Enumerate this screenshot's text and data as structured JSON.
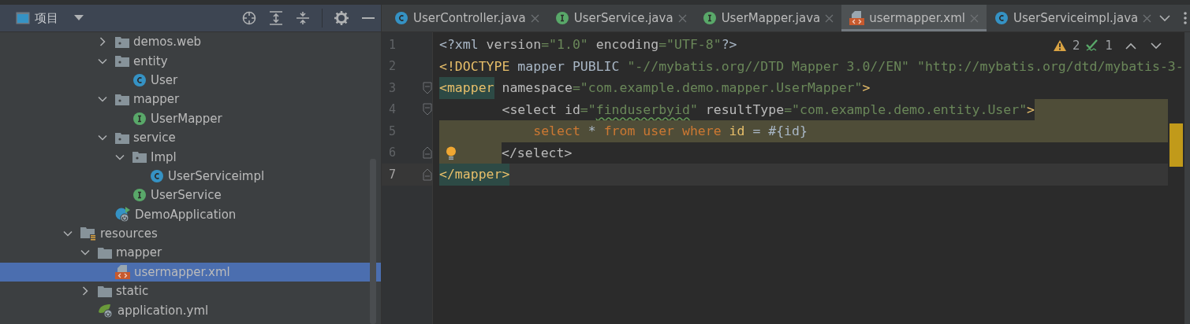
{
  "project_panel": {
    "title": "项目",
    "tree": [
      {
        "children": [
          {
            "children": [
              {
                "label": "demos.web",
                "kind": "package",
                "expanded": false
              },
              {
                "label": "entity",
                "kind": "package",
                "expanded": true,
                "children": [
                  {
                    "label": "User",
                    "kind": "class"
                  }
                ]
              },
              {
                "label": "mapper",
                "kind": "package",
                "expanded": true,
                "children": [
                  {
                    "label": "UserMapper",
                    "kind": "interface"
                  }
                ]
              },
              {
                "label": "service",
                "kind": "package",
                "expanded": true,
                "children": [
                  {
                    "label": "Impl",
                    "kind": "package",
                    "expanded": true,
                    "children": [
                      {
                        "label": "UserServiceimpl",
                        "kind": "class"
                      }
                    ]
                  },
                  {
                    "label": "UserService",
                    "kind": "interface"
                  }
                ]
              },
              {
                "label": "DemoApplication",
                "kind": "app"
              }
            ]
          }
        ]
      },
      {
        "label": "resources",
        "kind": "resources",
        "expanded": true,
        "children": [
          {
            "label": "mapper",
            "kind": "folder",
            "expanded": true,
            "children": [
              {
                "label": "usermapper.xml",
                "kind": "xml",
                "selected": true
              }
            ]
          },
          {
            "label": "static",
            "kind": "folder",
            "expanded": false
          },
          {
            "label": "application.yml",
            "kind": "yml"
          }
        ]
      }
    ]
  },
  "tabs": [
    {
      "label": "UserController.java",
      "kind": "class",
      "selected": false
    },
    {
      "label": "UserService.java",
      "kind": "interface",
      "selected": false
    },
    {
      "label": "UserMapper.java",
      "kind": "interface",
      "selected": false
    },
    {
      "label": "usermapper.xml",
      "kind": "xml",
      "selected": true
    },
    {
      "label": "UserServiceimpl.java",
      "kind": "class",
      "selected": false
    }
  ],
  "inspections": {
    "warnings": "2",
    "weak_warnings": "1"
  },
  "code_lines": [
    {
      "number": "1",
      "tokens": [
        {
          "text": "<?xml ",
          "kind": "plain"
        },
        {
          "text": "version",
          "kind": "attr"
        },
        {
          "text": "=\"1.0\" ",
          "kind": "value"
        },
        {
          "text": "encoding",
          "kind": "attr"
        },
        {
          "text": "=\"UTF-8\"",
          "kind": "value"
        },
        {
          "text": "?>",
          "kind": "plain"
        }
      ]
    },
    {
      "number": "2",
      "tokens": [
        {
          "text": "<!DOCTYPE ",
          "kind": "tag"
        },
        {
          "text": "mapper PUBLIC ",
          "kind": "plain"
        },
        {
          "text": "\"-//mybatis.org//DTD Mapper 3.0//EN\" \"http://mybatis.org/dtd/mybatis-3-",
          "kind": "value"
        }
      ]
    },
    {
      "number": "3",
      "fold_open": true,
      "tokens": [
        {
          "text": "<mapper",
          "kind": "tag",
          "matched": true
        },
        {
          "text": " namespace",
          "kind": "attr"
        },
        {
          "text": "=\"com.example.demo.mapper.UserMapper\"",
          "kind": "value"
        },
        {
          "text": ">",
          "kind": "tag"
        }
      ]
    },
    {
      "number": "4",
      "fold_open": true,
      "injected_tail": true,
      "tokens": [
        {
          "text": "        <select ",
          "kind": "attr"
        },
        {
          "text": "id",
          "kind": "attr"
        },
        {
          "text": "=\"",
          "kind": "value"
        },
        {
          "text": "finduserbyid",
          "kind": "value",
          "typo": true
        },
        {
          "text": "\" ",
          "kind": "value"
        },
        {
          "text": "resultType",
          "kind": "attr"
        },
        {
          "text": "=\"com.example.demo.entity.User\"",
          "kind": "value"
        },
        {
          "text": ">",
          "kind": "tag"
        }
      ]
    },
    {
      "number": "5",
      "injected": true,
      "tokens": [
        {
          "text": "            select ",
          "kind": "keyword"
        },
        {
          "text": "* ",
          "kind": "plain"
        },
        {
          "text": "from user where ",
          "kind": "keyword"
        },
        {
          "text": "id",
          "kind": "column"
        },
        {
          "text": " = #{id}",
          "kind": "plain"
        }
      ]
    },
    {
      "number": "6",
      "fold_close": true,
      "injected_indent": true,
      "bulb": true,
      "tokens": [
        {
          "text": "</select>",
          "kind": "attr"
        }
      ]
    },
    {
      "number": "7",
      "fold_close": true,
      "current": true,
      "tokens": [
        {
          "text": "</mapper",
          "kind": "tag",
          "matched": true
        },
        {
          "text": ">",
          "kind": "tag",
          "matched": true
        }
      ]
    }
  ]
}
